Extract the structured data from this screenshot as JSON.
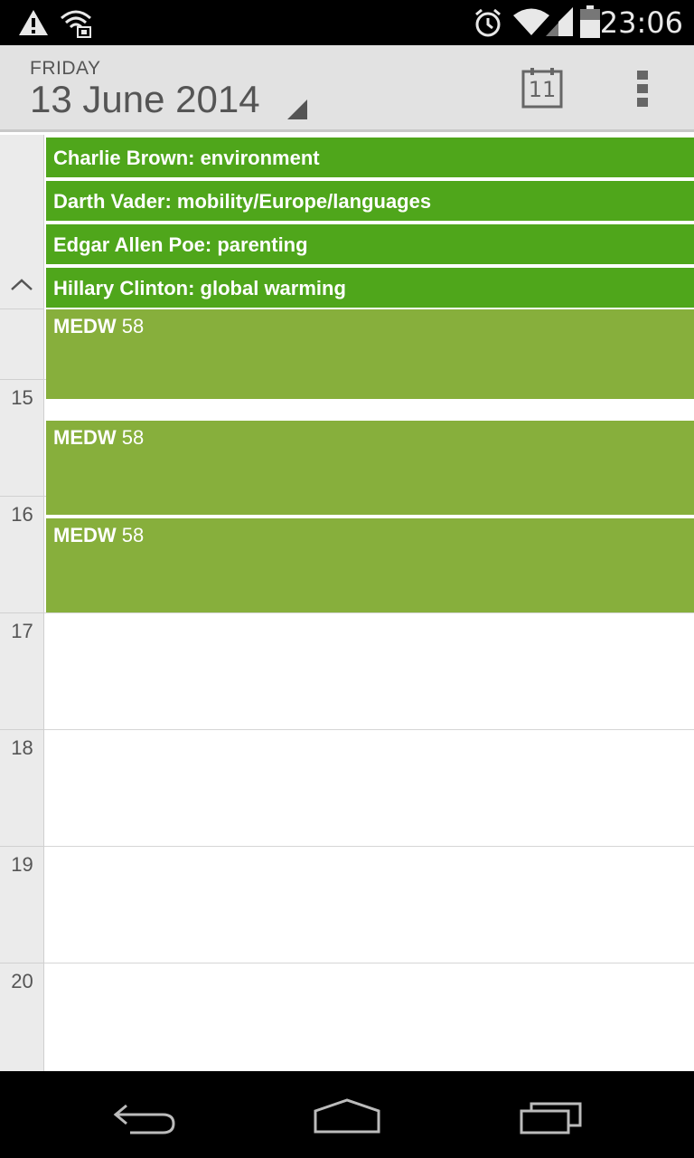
{
  "status_bar": {
    "time": "23:06",
    "icons": [
      "warning-icon",
      "wifi-alert-icon",
      "alarm-icon",
      "wifi-icon",
      "signal-icon",
      "battery-icon"
    ]
  },
  "header": {
    "weekday": "FRIDAY",
    "date": "13 June 2014",
    "today_day": "11",
    "icons": [
      "dropdown-triangle-icon",
      "today-calendar-icon",
      "overflow-menu-icon"
    ]
  },
  "all_day_events": [
    {
      "title": "Charlie Brown: environment"
    },
    {
      "title": "Darth Vader: mobility/Europe/languages"
    },
    {
      "title": "Edgar Allen Poe: parenting"
    },
    {
      "title": "Hillary Clinton: global warming"
    }
  ],
  "hours": [
    "15",
    "16",
    "17",
    "18",
    "19",
    "20"
  ],
  "events": [
    {
      "name": "MEDW",
      "room": "58"
    },
    {
      "name": "MEDW",
      "room": "58"
    },
    {
      "name": "MEDW",
      "room": "58"
    }
  ],
  "nav_bar": {
    "icons": [
      "back-icon",
      "home-icon",
      "recent-apps-icon"
    ]
  },
  "colors": {
    "all_day_event": "#4fa61b",
    "timed_event": "#87af3c",
    "action_bar": "#e2e2e2"
  }
}
